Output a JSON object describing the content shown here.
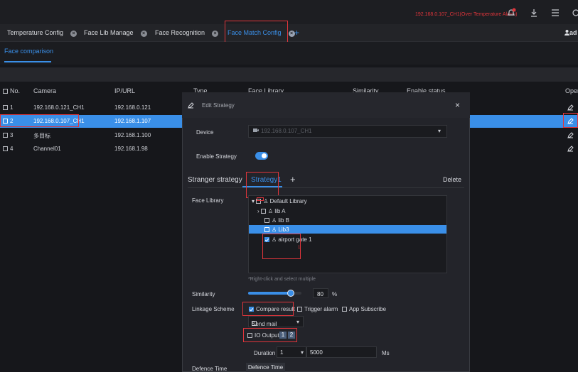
{
  "topbar": {
    "alarm": "192.168.0.107_CH1(Over Temperature Alarm)",
    "user": "ad"
  },
  "tabs": [
    {
      "label": "Temperature Config"
    },
    {
      "label": "Face Lib Manage"
    },
    {
      "label": "Face Recognition"
    },
    {
      "label": "Face Match Config"
    }
  ],
  "subtab": "Face comparison",
  "table": {
    "headers": {
      "no": "No.",
      "camera": "Camera",
      "ip": "IP/URL",
      "type": "Type",
      "lib": "Face Library",
      "similarity": "Similarity",
      "enable": "Enable status",
      "oper": "Oper"
    },
    "rows": [
      {
        "no": "1",
        "camera": "192.168.0.121_CH1",
        "ip": "192.168.0.121"
      },
      {
        "no": "2",
        "camera": "192.168.0.107_CH1",
        "ip": "192.168.1.107"
      },
      {
        "no": "3",
        "camera": "多目标",
        "ip": "192.168.1.100"
      },
      {
        "no": "4",
        "camera": "Channel01",
        "ip": "192.168.1.98"
      }
    ]
  },
  "modal": {
    "title": "Edit Strategy",
    "device_label": "Device",
    "device_value": "192.168.0.107_CH1",
    "enable_label": "Enable Strategy",
    "tab_stranger": "Stranger strategy",
    "tab_strategy1": "Strategy1",
    "plus": "+",
    "delete": "Delete",
    "face_library_label": "Face Library",
    "tree": [
      "Default Library",
      "lib A",
      "lib B",
      "Lib3",
      "airport gate 1"
    ],
    "tree_extra": "1",
    "hint": "*Right-click and select multiple",
    "similarity_label": "Similarity",
    "similarity_value": "80",
    "similarity_unit": "%",
    "similarity_level": 0.8,
    "linkage_label": "Linkage Scheme",
    "compare_result": "Compare result",
    "trigger_alarm": "Trigger alarm",
    "app_subscribe": "App Subscribe",
    "send_mail": "Send mail",
    "io_output": "IO Output",
    "io1": "1",
    "io2": "2",
    "duration_label": "Duration",
    "duration_value": "1",
    "duration_ms": "5000",
    "ms": "Ms",
    "defence_label": "Defence Time",
    "defence_button": "Defence Time"
  },
  "colors": {
    "accent": "#3a8fe8",
    "alert": "#e0353b",
    "bg": "#16171b"
  }
}
